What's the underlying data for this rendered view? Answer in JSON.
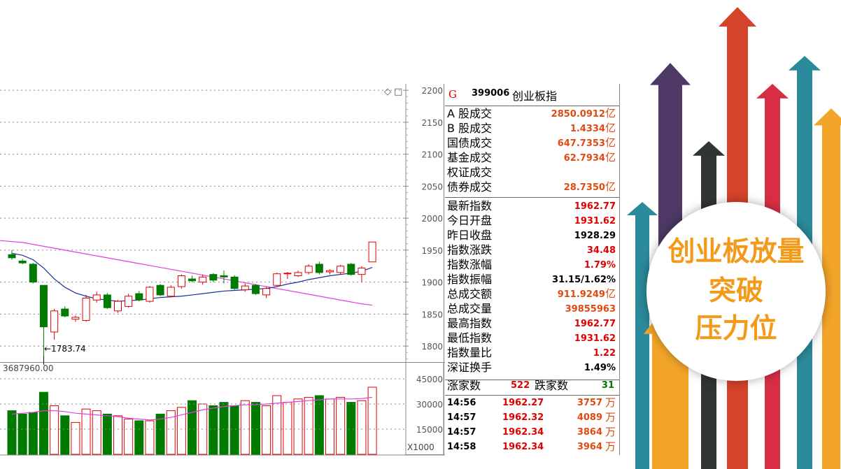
{
  "chart": {
    "price_axis_labels": [
      "2200",
      "2150",
      "2100",
      "2050",
      "2000",
      "1950",
      "1900",
      "1850",
      "1800"
    ],
    "volume_axis_labels": [
      "45000",
      "30000",
      "15000"
    ],
    "volume_unit": "X1000",
    "low_annotation": "←1783.74",
    "volume_header": "3687960.00",
    "corner_icons": "◇ □",
    "candles": [
      {
        "o": 1943,
        "h": 1950,
        "l": 1935,
        "c": 1938
      },
      {
        "o": 1933,
        "h": 1936,
        "l": 1928,
        "c": 1930
      },
      {
        "o": 1928,
        "h": 1930,
        "l": 1898,
        "c": 1900
      },
      {
        "o": 1895,
        "h": 1895,
        "l": 1783.74,
        "c": 1830
      },
      {
        "o": 1822,
        "h": 1858,
        "l": 1810,
        "c": 1855
      },
      {
        "o": 1858,
        "h": 1862,
        "l": 1845,
        "c": 1847
      },
      {
        "o": 1842,
        "h": 1848,
        "l": 1838,
        "c": 1845
      },
      {
        "o": 1840,
        "h": 1880,
        "l": 1838,
        "c": 1875
      },
      {
        "o": 1872,
        "h": 1885,
        "l": 1868,
        "c": 1880
      },
      {
        "o": 1880,
        "h": 1883,
        "l": 1858,
        "c": 1860
      },
      {
        "o": 1855,
        "h": 1872,
        "l": 1852,
        "c": 1870
      },
      {
        "o": 1862,
        "h": 1882,
        "l": 1860,
        "c": 1878
      },
      {
        "o": 1882,
        "h": 1886,
        "l": 1870,
        "c": 1872
      },
      {
        "o": 1870,
        "h": 1894,
        "l": 1868,
        "c": 1892
      },
      {
        "o": 1895,
        "h": 1897,
        "l": 1878,
        "c": 1880
      },
      {
        "o": 1878,
        "h": 1895,
        "l": 1876,
        "c": 1892
      },
      {
        "o": 1893,
        "h": 1912,
        "l": 1890,
        "c": 1910
      },
      {
        "o": 1905,
        "h": 1910,
        "l": 1900,
        "c": 1902
      },
      {
        "o": 1900,
        "h": 1912,
        "l": 1896,
        "c": 1908
      },
      {
        "o": 1912,
        "h": 1914,
        "l": 1900,
        "c": 1903
      },
      {
        "o": 1910,
        "h": 1918,
        "l": 1898,
        "c": 1908
      },
      {
        "o": 1908,
        "h": 1911,
        "l": 1888,
        "c": 1890
      },
      {
        "o": 1888,
        "h": 1898,
        "l": 1885,
        "c": 1894
      },
      {
        "o": 1895,
        "h": 1897,
        "l": 1880,
        "c": 1882
      },
      {
        "o": 1880,
        "h": 1893,
        "l": 1875,
        "c": 1890
      },
      {
        "o": 1895,
        "h": 1915,
        "l": 1893,
        "c": 1913
      },
      {
        "o": 1914,
        "h": 1916,
        "l": 1905,
        "c": 1914
      },
      {
        "o": 1910,
        "h": 1918,
        "l": 1908,
        "c": 1915
      },
      {
        "o": 1915,
        "h": 1928,
        "l": 1912,
        "c": 1925
      },
      {
        "o": 1928,
        "h": 1932,
        "l": 1912,
        "c": 1915
      },
      {
        "o": 1916,
        "h": 1920,
        "l": 1912,
        "c": 1918
      },
      {
        "o": 1915,
        "h": 1927,
        "l": 1912,
        "c": 1925
      },
      {
        "o": 1928,
        "h": 1930,
        "l": 1910,
        "c": 1912
      },
      {
        "o": 1912,
        "h": 1925,
        "l": 1900,
        "c": 1922
      },
      {
        "o": 1931.62,
        "h": 1962.77,
        "l": 1931.62,
        "c": 1962.77
      }
    ],
    "ma_slow": [
      1965,
      1962,
      1959,
      1956,
      1953,
      1950,
      1947,
      1944,
      1941,
      1938,
      1935,
      1932,
      1929,
      1926,
      1923,
      1920,
      1917,
      1914,
      1911,
      1908,
      1905,
      1902,
      1899,
      1896,
      1893,
      1890,
      1887,
      1884,
      1881,
      1878,
      1875,
      1872,
      1869,
      1866,
      1864
    ],
    "ma_fast": [
      1945,
      1942,
      1935,
      1922,
      1905,
      1892,
      1883,
      1878,
      1874,
      1872,
      1870,
      1871,
      1872,
      1874,
      1876,
      1877,
      1878,
      1880,
      1882,
      1884,
      1886,
      1887,
      1888,
      1889,
      1890,
      1893,
      1897,
      1900,
      1904,
      1907,
      1910,
      1912,
      1914,
      1917,
      1923
    ],
    "volumes": [
      26000,
      24000,
      25000,
      37000,
      29000,
      23000,
      19000,
      27000,
      26000,
      24000,
      23000,
      21000,
      20000,
      20000,
      24000,
      26000,
      28000,
      32000,
      30000,
      29000,
      31000,
      29000,
      32000,
      31000,
      29000,
      35000,
      31000,
      33000,
      34000,
      35000,
      33000,
      34000,
      31000,
      32000,
      40000
    ],
    "vol_ma": [
      24000,
      24500,
      25000,
      26000,
      26000,
      25500,
      24500,
      24000,
      23500,
      23000,
      22500,
      21500,
      21000,
      20500,
      21000,
      22000,
      23500,
      25000,
      26500,
      27500,
      28500,
      29000,
      29500,
      29500,
      30000,
      30500,
      31000,
      31500,
      32000,
      32500,
      33000,
      33000,
      33000,
      33200,
      34000
    ],
    "price_range": [
      1775,
      2210
    ],
    "volume_range": [
      0,
      50000
    ]
  },
  "panel": {
    "header": {
      "g": "G",
      "code": "399006",
      "name": "创业板指"
    },
    "turnover": [
      {
        "label": "A 股成交",
        "value": "2850.0912",
        "unit": "亿",
        "color": "orange"
      },
      {
        "label": "B 股成交",
        "value": "1.4334",
        "unit": "亿",
        "color": "orange"
      },
      {
        "label": "国债成交",
        "value": "647.7353",
        "unit": "亿",
        "color": "orange"
      },
      {
        "label": "基金成交",
        "value": "62.7934",
        "unit": "亿",
        "color": "orange"
      },
      {
        "label": "权证成交",
        "value": "",
        "unit": "",
        "color": "orange"
      },
      {
        "label": "债券成交",
        "value": "28.7350",
        "unit": "亿",
        "color": "orange"
      }
    ],
    "stats": [
      {
        "label": "最新指数",
        "value": "1962.77",
        "unit": "",
        "color": "red"
      },
      {
        "label": "今日开盘",
        "value": "1931.62",
        "unit": "",
        "color": "red"
      },
      {
        "label": "昨日收盘",
        "value": "1928.29",
        "unit": "",
        "color": "black"
      },
      {
        "label": "指数涨跌",
        "value": "34.48",
        "unit": "",
        "color": "red"
      },
      {
        "label": "指数涨幅",
        "value": "1.79%",
        "unit": "",
        "color": "red"
      },
      {
        "label": "指数振幅",
        "value": "31.15/1.62%",
        "unit": "",
        "color": "black"
      },
      {
        "label": "总成交额",
        "value": "911.9249",
        "unit": "亿",
        "color": "orange"
      },
      {
        "label": "总成交量",
        "value": "39855963",
        "unit": "",
        "color": "orange"
      },
      {
        "label": "最高指数",
        "value": "1962.77",
        "unit": "",
        "color": "red"
      },
      {
        "label": "最低指数",
        "value": "1931.62",
        "unit": "",
        "color": "red"
      },
      {
        "label": "指数量比",
        "value": "1.22",
        "unit": "",
        "color": "red"
      },
      {
        "label": "深证换手",
        "value": "1.49%",
        "unit": "",
        "color": "black"
      }
    ],
    "updown": {
      "up_label": "涨家数",
      "up_value": "522",
      "down_label": "跌家数",
      "down_value": "31"
    },
    "ticks": [
      {
        "time": "14:56",
        "price": "1962.27",
        "vol": "3757",
        "unit": "万"
      },
      {
        "time": "14:57",
        "price": "1962.32",
        "vol": "4089",
        "unit": "万"
      },
      {
        "time": "14:57",
        "price": "1962.34",
        "vol": "3864",
        "unit": "万"
      },
      {
        "time": "14:58",
        "price": "1962.34",
        "vol": "3964",
        "unit": "万"
      }
    ]
  },
  "promo": {
    "line1": "创业板放量",
    "line2": "突破",
    "line3": "压力位"
  },
  "colors": {
    "up": "#e00000",
    "down": "#007a00",
    "ma_slow": "#e040e0",
    "ma_fast": "#1a2ea0",
    "vol_ma": "#e040e0",
    "arrow_orange": "#f3a52a",
    "arrow_purple": "#4e3866",
    "arrow_red": "#d4432a",
    "arrow_teal": "#2b8a9b",
    "arrow_dark": "#2f3534",
    "arrow_crimson": "#d62f45"
  }
}
